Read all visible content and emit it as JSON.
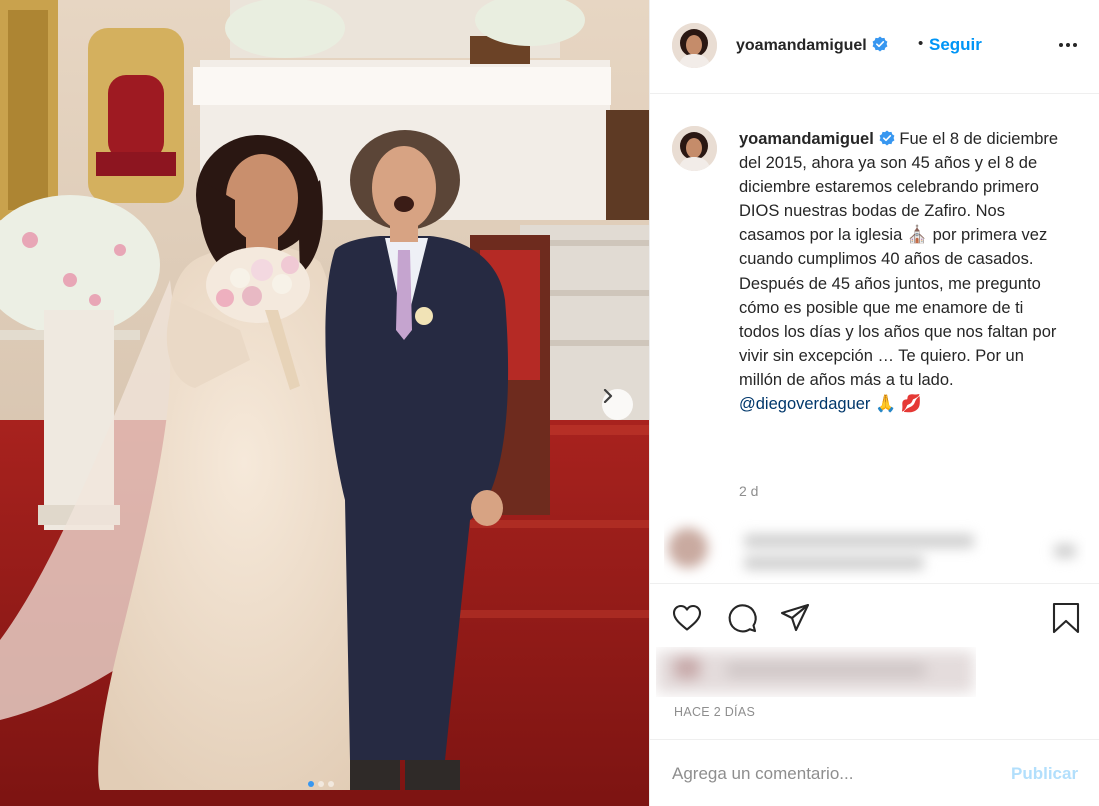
{
  "post": {
    "username": "yoamandamiguel",
    "verified": true,
    "header": {
      "separator": "•",
      "follow_label": "Seguir",
      "more_icon": "more-horizontal-icon"
    },
    "caption": {
      "text_part1": "Fue el 8 de diciembre del 2015, ahora ya son 45 años y el 8 de diciembre estaremos celebrando primero DIOS nuestras bodas de Zafiro. Nos casamos por la iglesia",
      "church_emoji": "⛪",
      "text_part2": "por primera vez cuando cumplimos 40 años de casados. Después de 45 años juntos, me pregunto cómo es posible que me enamore de ti todos los días y los años que nos faltan por vivir sin excepción … Te quiero. Por un millón de años más a tu lado.",
      "mention": "@diegoverdaguer",
      "emoji_tail_1": "🙏",
      "emoji_tail_2": "💋",
      "time_ago": "2 d"
    },
    "actions": {
      "like_icon": "heart-icon",
      "comment_icon": "comment-icon",
      "share_icon": "share-icon",
      "save_icon": "bookmark-icon"
    },
    "timestamp": "HACE 2 DÍAS",
    "comment_box": {
      "placeholder": "Agrega un comentario...",
      "post_label": "Publicar"
    },
    "carousel": {
      "next_icon": "chevron-right-icon",
      "total_slides": 3,
      "active_slide": 1
    }
  },
  "colors": {
    "link_blue": "#0095f6",
    "verified_blue": "#3897f0",
    "post_disabled": "#b2dffc",
    "muted_text": "#8e8e8e"
  }
}
